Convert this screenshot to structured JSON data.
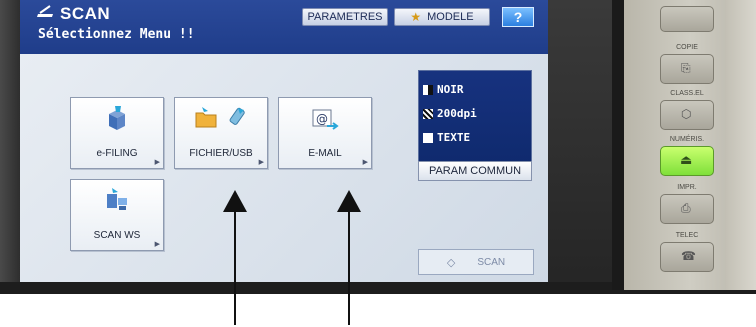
{
  "header": {
    "title": "SCAN",
    "subtitle": "Sélectionnez Menu !!",
    "parametres_label": "PARAMETRES",
    "modele_label": "MODELE",
    "help_label": "?"
  },
  "menu": {
    "tiles": [
      {
        "label": "e-FILING"
      },
      {
        "label": "FICHIER/USB"
      },
      {
        "label": "E-MAIL"
      },
      {
        "label": "SCAN WS"
      }
    ]
  },
  "status": {
    "color": "NOIR",
    "resolution": "200dpi",
    "mode": "TEXTE"
  },
  "buttons": {
    "param_commun": "PARAM COMMUN",
    "scan": "SCAN"
  },
  "machine_panel": {
    "copie": "COPIE",
    "class_el": "CLASS.EL",
    "numeris": "NUMÉRIS.",
    "impr": "IMPR.",
    "telec": "TELEC"
  },
  "colors": {
    "header_blue": "#1f3d8a",
    "status_blue": "#0f2a6e",
    "scan_key_green": "#7fe03a"
  }
}
